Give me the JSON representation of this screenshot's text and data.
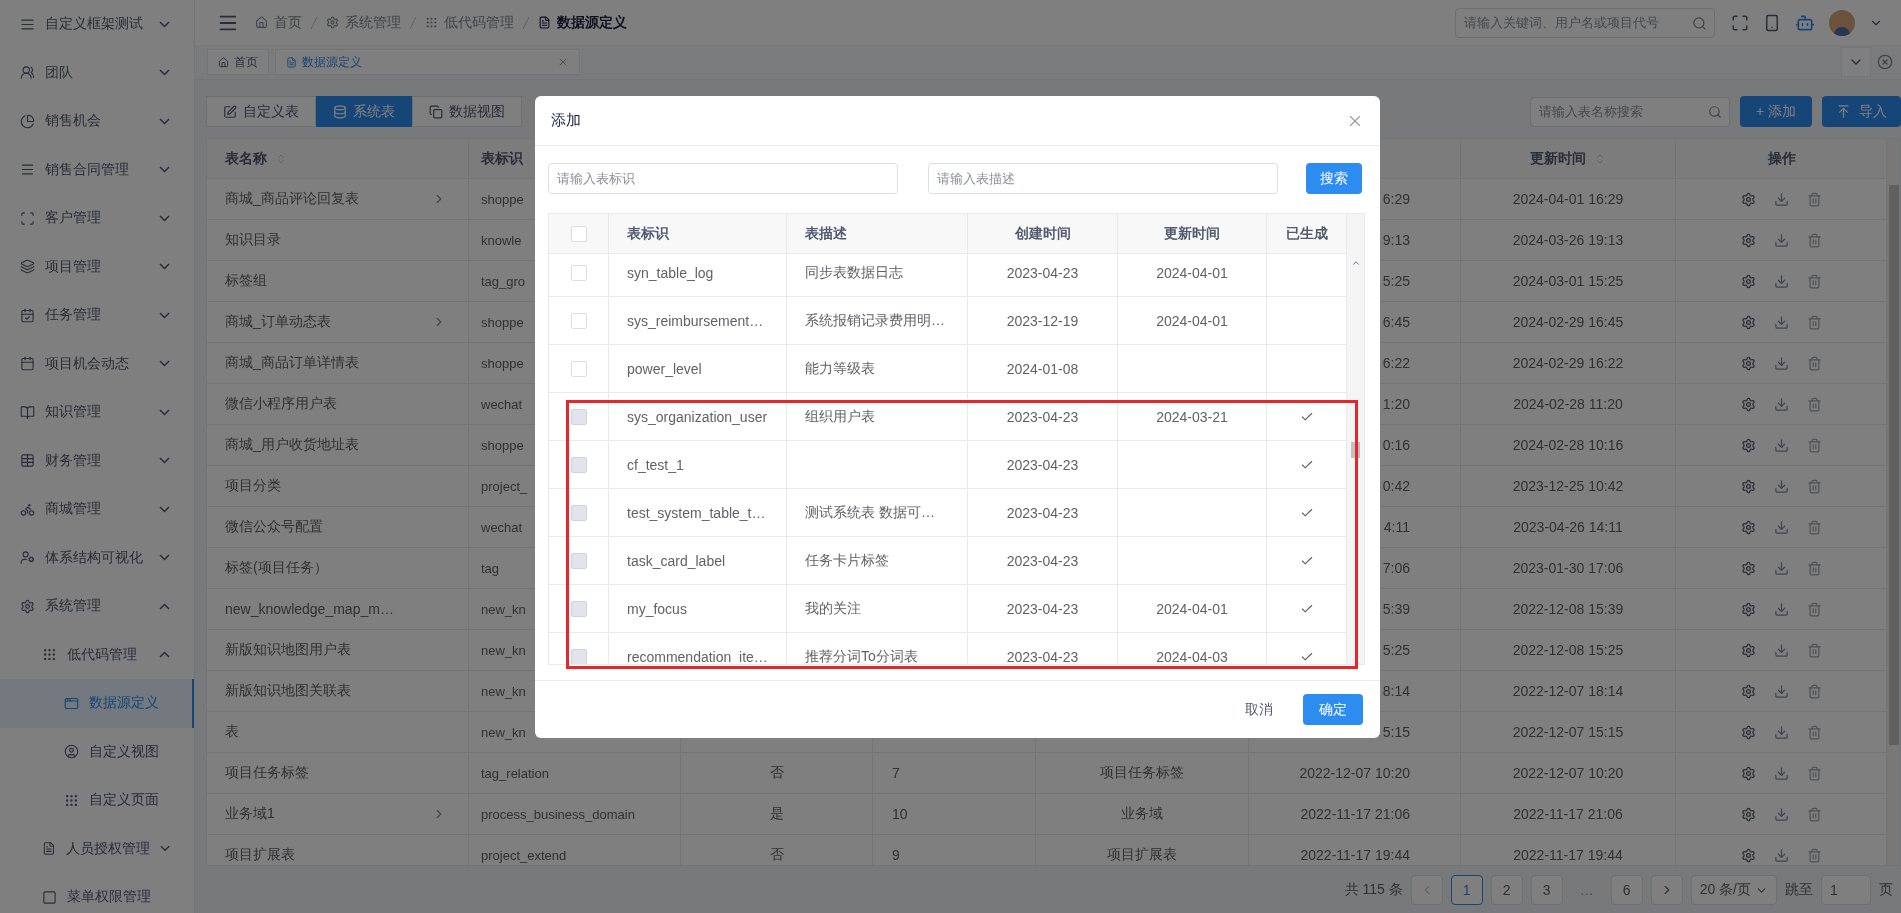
{
  "sidebar": {
    "items": [
      {
        "label": "自定义框架测试",
        "expanded": false
      },
      {
        "label": "团队",
        "expanded": false
      },
      {
        "label": "销售机会",
        "expanded": false
      },
      {
        "label": "销售合同管理",
        "expanded": false
      },
      {
        "label": "客户管理",
        "expanded": false
      },
      {
        "label": "项目管理",
        "expanded": false
      },
      {
        "label": "任务管理",
        "expanded": false
      },
      {
        "label": "项目机会动态",
        "expanded": false
      },
      {
        "label": "知识管理",
        "expanded": false
      },
      {
        "label": "财务管理",
        "expanded": false
      },
      {
        "label": "商城管理",
        "expanded": false
      },
      {
        "label": "体系结构可视化",
        "expanded": false
      },
      {
        "label": "系统管理",
        "expanded": true,
        "children": [
          {
            "label": "低代码管理",
            "expanded": true,
            "children": [
              {
                "label": "数据源定义",
                "selected": true
              },
              {
                "label": "自定义视图",
                "selected": false
              },
              {
                "label": "自定义页面",
                "selected": false
              }
            ]
          },
          {
            "label": "人员授权管理",
            "expanded": false
          },
          {
            "label": "菜单权限管理",
            "selected": false
          }
        ]
      }
    ]
  },
  "header": {
    "breadcrumb": [
      "首页",
      "系统管理",
      "低代码管理",
      "数据源定义"
    ],
    "search": {
      "placeholder": "请输入关键词、用户名或项目代号"
    }
  },
  "tabs": [
    {
      "label": "首页",
      "selected": false,
      "closable": false
    },
    {
      "label": "数据源定义",
      "selected": true,
      "closable": true
    }
  ],
  "toolbar": {
    "segments": [
      {
        "label": "自定义表",
        "selected": false
      },
      {
        "label": "系统表",
        "selected": true
      },
      {
        "label": "数据视图",
        "selected": false
      }
    ],
    "search": {
      "placeholder": "请输入表名称搜索"
    },
    "add_button": "+ 添加",
    "import_button": "导入"
  },
  "table": {
    "column_headers": {
      "name": {
        "label": "表名称",
        "sortable": true
      },
      "identifier": {
        "label": "表标识"
      },
      "updated": {
        "label": "更新时间",
        "sortable": true
      },
      "actions": {
        "label": "操作"
      }
    },
    "rows": [
      {
        "name": "商城_商品评论回复表",
        "expandable": true,
        "identifier": "shoppe",
        "column_6": "6:29",
        "updated": "2024-04-01 16:29"
      },
      {
        "name": "知识目录",
        "identifier": "knowle",
        "column_6": "9:13",
        "updated": "2024-03-26 19:13"
      },
      {
        "name": "标签组",
        "identifier": "tag_gro",
        "column_6": "5:25",
        "updated": "2024-03-01 15:25"
      },
      {
        "name": "商城_订单动态表",
        "expandable": true,
        "identifier": "shoppe",
        "column_6": "6:45",
        "updated": "2024-02-29 16:45"
      },
      {
        "name": "商城_商品订单详情表",
        "identifier": "shoppe",
        "column_6": "6:22",
        "updated": "2024-02-29 16:22"
      },
      {
        "name": "微信小程序用户表",
        "identifier": "wechat",
        "column_6": "1:20",
        "updated": "2024-02-28 11:20"
      },
      {
        "name": "商城_用户收货地址表",
        "identifier": "shoppe",
        "column_6": "0:16",
        "updated": "2024-02-28 10:16"
      },
      {
        "name": "项目分类",
        "identifier": "project_",
        "column_6": "0:42",
        "updated": "2023-12-25 10:42"
      },
      {
        "name": "微信公众号配置",
        "identifier": "wechat",
        "column_6": "4:11",
        "updated": "2023-04-26 14:11"
      },
      {
        "name": "标签(项目任务）",
        "identifier": "tag",
        "column_6": "7:06",
        "updated": "2023-01-30 17:06"
      },
      {
        "name": "new_knowledge_map_m…",
        "identifier": "new_kn",
        "column_6": "5:39",
        "updated": "2022-12-08 15:39"
      },
      {
        "name": "新版知识地图用户表",
        "identifier": "new_kn",
        "column_6": "5:25",
        "updated": "2022-12-08 15:25"
      },
      {
        "name": "新版知识地图关联表",
        "identifier": "new_kn",
        "column_6": "8:14",
        "updated": "2022-12-07 18:14"
      },
      {
        "name": "表",
        "identifier": "new_kn",
        "column_6": "5:15",
        "updated": "2022-12-07 15:15"
      },
      {
        "name": "项目任务标签",
        "identifier": "tag_relation",
        "column_3": "否",
        "column_4": "7",
        "column_5": "项目任务标签",
        "column_6": "2022-12-07 10:20",
        "updated": "2022-12-07 10:20"
      },
      {
        "name": "业务域1",
        "expandable": true,
        "identifier": "process_business_domain",
        "column_3": "是",
        "column_4": "10",
        "column_5": "业务域",
        "column_6": "2022-11-17 21:06",
        "updated": "2022-11-17 21:06"
      },
      {
        "name": "项目扩展表",
        "identifier": "project_extend",
        "column_3": "否",
        "column_4": "9",
        "column_5": "项目扩展表",
        "column_6": "2022-11-17 19:44",
        "updated": "2022-11-17 19:44"
      }
    ]
  },
  "pagination": {
    "total": "共 115 条",
    "pages": [
      {
        "label": "1",
        "kind": "page",
        "selected": true
      },
      {
        "label": "2",
        "kind": "page",
        "selected": false
      },
      {
        "label": "3",
        "kind": "page",
        "selected": false
      },
      {
        "label": "…",
        "kind": "ellipsis",
        "selected": false
      },
      {
        "label": "6",
        "kind": "page",
        "selected": false
      }
    ],
    "page_size": "20 条/页",
    "jump_label": "跳至",
    "jump_value": "1",
    "jump_suffix": "页"
  },
  "dialog": {
    "title": "添加",
    "fields": [
      {
        "placeholder": "请输入表标识"
      },
      {
        "placeholder": "请输入表描述"
      }
    ],
    "search_button": "搜索",
    "table": {
      "select_all": false,
      "columns": [
        "表标识",
        "表描述",
        "创建时间",
        "更新时间",
        "已生成"
      ],
      "rows": [
        {
          "checked": false,
          "disabled": false,
          "identifier": "syn_table_log",
          "description": "同步表数据日志",
          "created": "2023-04-23",
          "updated": "2024-04-01"
        },
        {
          "checked": false,
          "disabled": false,
          "identifier": "sys_reimbursement…",
          "description": "系统报销记录费用明…",
          "created": "2023-12-19",
          "updated": "2024-04-01"
        },
        {
          "checked": false,
          "disabled": false,
          "identifier": "power_level",
          "description": "能力等级表",
          "created": "2024-01-08"
        },
        {
          "checked": false,
          "disabled": true,
          "identifier": "sys_organization_user",
          "description": "组织用户表",
          "created": "2023-04-23",
          "updated": "2024-03-21",
          "generated": true
        },
        {
          "checked": false,
          "disabled": true,
          "identifier": "cf_test_1",
          "created": "2023-04-23",
          "generated": true
        },
        {
          "checked": false,
          "disabled": true,
          "identifier": "test_system_table_t…",
          "description": "测试系统表 数据可…",
          "created": "2023-04-23",
          "generated": true
        },
        {
          "checked": false,
          "disabled": true,
          "identifier": "task_card_label",
          "description": "任务卡片标签",
          "created": "2023-04-23",
          "generated": true
        },
        {
          "checked": false,
          "disabled": true,
          "identifier": "my_focus",
          "description": "我的关注",
          "created": "2023-04-23",
          "updated": "2024-04-01",
          "generated": true
        },
        {
          "checked": false,
          "disabled": true,
          "identifier": "recommendation_ite…",
          "description": "推荐分词To分词表",
          "created": "2023-04-23",
          "updated": "2024-04-03",
          "generated": true
        }
      ]
    },
    "cancel_button": "取消",
    "confirm_button": "确定"
  }
}
